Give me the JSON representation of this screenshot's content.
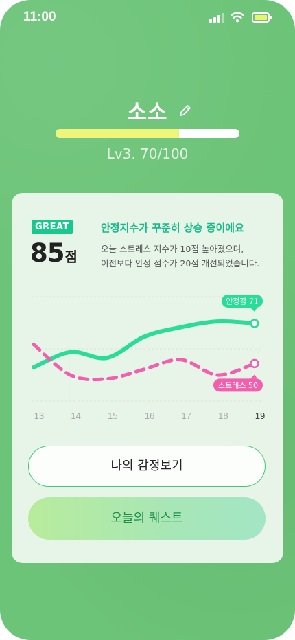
{
  "status_bar": {
    "time": "11:00",
    "icons": [
      "cellular-signal-icon",
      "wifi-icon",
      "battery-icon"
    ]
  },
  "profile": {
    "name": "소소",
    "edit_icon": "pencil-icon",
    "level_label": "Lv3. 70/100",
    "level_progress": 0.67
  },
  "report": {
    "grade": "GREAT",
    "score": "85",
    "score_unit": "점",
    "headline": "안정지수가 꾸준히 상승 중이에요",
    "description_line1": "오늘 스트레스 지수가 10점 높아졌으며,",
    "description_line2": "이전보다 안정 점수가 20점 개선되었습니다."
  },
  "chart_data": {
    "type": "line",
    "x": [
      "13",
      "14",
      "15",
      "16",
      "17",
      "18",
      "19"
    ],
    "series": [
      {
        "name": "안정감",
        "label": "안정감 71",
        "color": "#29dc98",
        "style": "solid",
        "values": [
          48,
          56,
          53,
          64,
          69,
          72,
          71
        ]
      },
      {
        "name": "스트레스",
        "label": "스트레스 50",
        "color": "#f15fae",
        "style": "dashed",
        "values": [
          60,
          44,
          42,
          47,
          52,
          44,
          50
        ]
      }
    ],
    "ylim": [
      30,
      85
    ],
    "grid": true,
    "colors": {
      "grid": "#d8e4d8",
      "tick": "#aaaaaa",
      "tick_active": "#444444"
    }
  },
  "actions": {
    "view_emotions": "나의 감정보기",
    "daily_quest": "오늘의 퀘스트"
  }
}
